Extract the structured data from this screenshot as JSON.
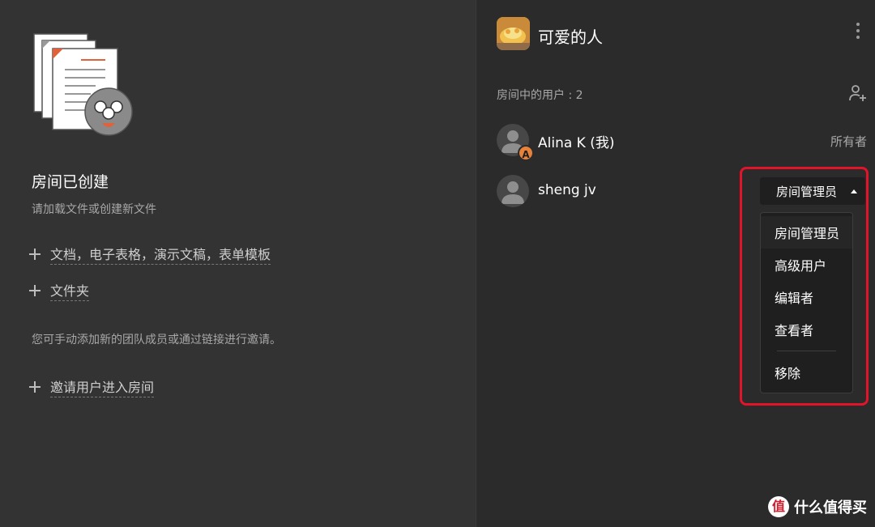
{
  "left": {
    "title": "房间已创建",
    "subtitle": "请加载文件或创建新文件",
    "actions": [
      {
        "label": "文档，电子表格，演示文稿，表单模板"
      },
      {
        "label": "文件夹"
      }
    ],
    "invite_note": "您可手动添加新的团队成员或通过链接进行邀请。",
    "invite_action": "邀请用户进入房间"
  },
  "header": {
    "room_name": "可爱的人",
    "more_icon": "more-vertical-icon"
  },
  "members": {
    "count_label": "房间中的用户 : 2",
    "add_icon": "add-user-icon",
    "users": [
      {
        "name": "Alina K (我)",
        "role": "所有者",
        "badge": "A"
      },
      {
        "name": "sheng jv",
        "role": "房间管理员"
      }
    ]
  },
  "role_menu": {
    "items": [
      "房间管理员",
      "高级用户",
      "编辑者",
      "查看者"
    ],
    "remove": "移除"
  },
  "watermark": {
    "icon": "值",
    "text": "什么值得买"
  },
  "colors": {
    "highlight": "#e3132a",
    "badge": "#e8823a"
  }
}
